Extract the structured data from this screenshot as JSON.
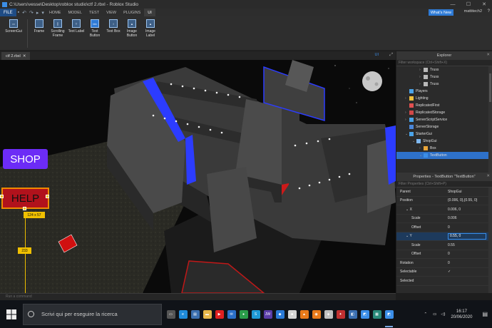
{
  "window": {
    "title": "C:\\Users\\vesse\\Desktop\\roblox studio\\ctf 2.rbxl - Roblox Studio"
  },
  "menubar": {
    "file_label": "FILE",
    "tabs": [
      {
        "label": "HOME"
      },
      {
        "label": "MODEL"
      },
      {
        "label": "TEST"
      },
      {
        "label": "VIEW"
      },
      {
        "label": "PLUGINS"
      },
      {
        "label": "UI"
      }
    ],
    "whats_new": "What's New",
    "username": "mattitech2"
  },
  "ribbon": {
    "items": [
      {
        "label": "ScreenGui",
        "icon": "screengui-icon"
      },
      {
        "label": "Frame",
        "icon": "frame-icon"
      },
      {
        "label": "Scrolling Frame",
        "icon": "scrolling-frame-icon"
      },
      {
        "label": "Text Label",
        "icon": "text-label-icon"
      },
      {
        "label": "Text Button",
        "icon": "text-button-icon"
      },
      {
        "label": "Text Box",
        "icon": "text-box-icon"
      },
      {
        "label": "Image Button",
        "icon": "image-button-icon"
      },
      {
        "label": "Image Label",
        "icon": "image-label-icon"
      }
    ]
  },
  "doc": {
    "tab": "ctf 2.rbxl",
    "ui_toggle": "UI"
  },
  "viewport": {
    "shop_label": "SHOP",
    "help_label": "HELP",
    "size_badge": "124 x 57",
    "y_badge": "233"
  },
  "command_bar": {
    "placeholder": "Run a command"
  },
  "explorer": {
    "title": "Explorer",
    "filter_placeholder": "Filter workspace (Ctrl+Shift+X)",
    "items": [
      {
        "label": "Truss",
        "indent": 2,
        "icon": "part-icon",
        "color": "#b8b8b8",
        "caret": "›"
      },
      {
        "label": "Truss",
        "indent": 2,
        "icon": "part-icon",
        "color": "#b8b8b8",
        "caret": "›"
      },
      {
        "label": "Truss",
        "indent": 2,
        "icon": "part-icon",
        "color": "#b8b8b8",
        "caret": "›"
      },
      {
        "label": "Players",
        "indent": 0,
        "icon": "players-icon",
        "color": "#4aa3e8",
        "caret": ""
      },
      {
        "label": "Lighting",
        "indent": 0,
        "icon": "lighting-icon",
        "color": "#f0c03a",
        "caret": "›"
      },
      {
        "label": "ReplicatedFirst",
        "indent": 0,
        "icon": "replicated-first-icon",
        "color": "#e05050",
        "caret": ""
      },
      {
        "label": "ReplicatedStorage",
        "indent": 0,
        "icon": "replicated-storage-icon",
        "color": "#d04848",
        "caret": "›"
      },
      {
        "label": "ServerScriptService",
        "indent": 0,
        "icon": "server-script-service-icon",
        "color": "#4aa3e8",
        "caret": "›"
      },
      {
        "label": "ServerStorage",
        "indent": 0,
        "icon": "server-storage-icon",
        "color": "#4a86d8",
        "caret": ""
      },
      {
        "label": "StarterGui",
        "indent": 0,
        "icon": "starter-gui-icon",
        "color": "#4aa3e8",
        "caret": "⌄"
      },
      {
        "label": "ShopGui",
        "indent": 1,
        "icon": "screengui-icon",
        "color": "#7fb8f0",
        "caret": "⌄"
      },
      {
        "label": "Box",
        "indent": 2,
        "icon": "frame-icon",
        "color": "#e8a53a",
        "caret": "›"
      },
      {
        "label": "TextButton",
        "indent": 2,
        "icon": "text-button-icon",
        "color": "#3b8ee8",
        "caret": "⌄",
        "selected": true
      }
    ]
  },
  "properties": {
    "title": "Properties - TextButton \"TextButton\"",
    "filter_placeholder": "Filter Properties (Ctrl+Shift+P)",
    "rows": [
      {
        "name": "Parent",
        "value": "ShopGui",
        "indent": 0
      },
      {
        "name": "Position",
        "value": "{0.006, 0},{0.55, 0}",
        "indent": 0
      },
      {
        "name": "X",
        "value": "0.006, 0",
        "indent": 1,
        "caret": "⌄"
      },
      {
        "name": "Scale",
        "value": "0.006",
        "indent": 2
      },
      {
        "name": "Offset",
        "value": "0",
        "indent": 2
      },
      {
        "name": "Y",
        "value": "0.55, 0",
        "indent": 1,
        "caret": "⌄",
        "editing": true
      },
      {
        "name": "Scale",
        "value": "0.55",
        "indent": 2
      },
      {
        "name": "Offset",
        "value": "0",
        "indent": 2
      },
      {
        "name": "Rotation",
        "value": "0",
        "indent": 0
      },
      {
        "name": "Selectable",
        "value": "✓",
        "indent": 0,
        "checkbox": true
      },
      {
        "name": "Selected",
        "value": "",
        "indent": 0,
        "checkbox": true
      }
    ]
  },
  "taskbar": {
    "search_placeholder": "Scrivi qui per eseguire la ricerca",
    "apps": [
      {
        "name": "task-view-icon",
        "color": "#555",
        "glyph": "▭"
      },
      {
        "name": "edge-icon",
        "color": "#1f8ad9",
        "glyph": "e"
      },
      {
        "name": "store-icon",
        "color": "#3b6fb0",
        "glyph": "▤"
      },
      {
        "name": "explorer-icon",
        "color": "#e8b84a",
        "glyph": "▬"
      },
      {
        "name": "youtube-icon",
        "color": "#e02020",
        "glyph": "▶"
      },
      {
        "name": "mail-icon",
        "color": "#2a6fc9",
        "glyph": "✉"
      },
      {
        "name": "chrome-icon",
        "color": "#2a9d4a",
        "glyph": "●"
      },
      {
        "name": "skype-icon",
        "color": "#1e9ad6",
        "glyph": "S"
      },
      {
        "name": "jw-icon",
        "color": "#5a3da8",
        "glyph": "JW"
      },
      {
        "name": "app-icon",
        "color": "#2a7ad6",
        "glyph": "◆"
      },
      {
        "name": "roblox-icon",
        "color": "#d4d4d4",
        "glyph": "■"
      },
      {
        "name": "vlc-icon",
        "color": "#e87a1a",
        "glyph": "▲"
      },
      {
        "name": "blender-icon",
        "color": "#e87a1a",
        "glyph": "◉"
      },
      {
        "name": "app2-icon",
        "color": "#c0c0c0",
        "glyph": "◈"
      },
      {
        "name": "app3-icon",
        "color": "#c03030",
        "glyph": "✦"
      },
      {
        "name": "app4-icon",
        "color": "#3b6fb0",
        "glyph": "◧"
      },
      {
        "name": "roblox-studio-icon",
        "color": "#3b8ee8",
        "glyph": "◩"
      },
      {
        "name": "app5-icon",
        "color": "#2a8a7a",
        "glyph": "▦"
      },
      {
        "name": "app6-icon",
        "color": "#3b8ee8",
        "glyph": "◩",
        "active": true
      }
    ],
    "time": "16:17",
    "date": "20/06/2020"
  }
}
